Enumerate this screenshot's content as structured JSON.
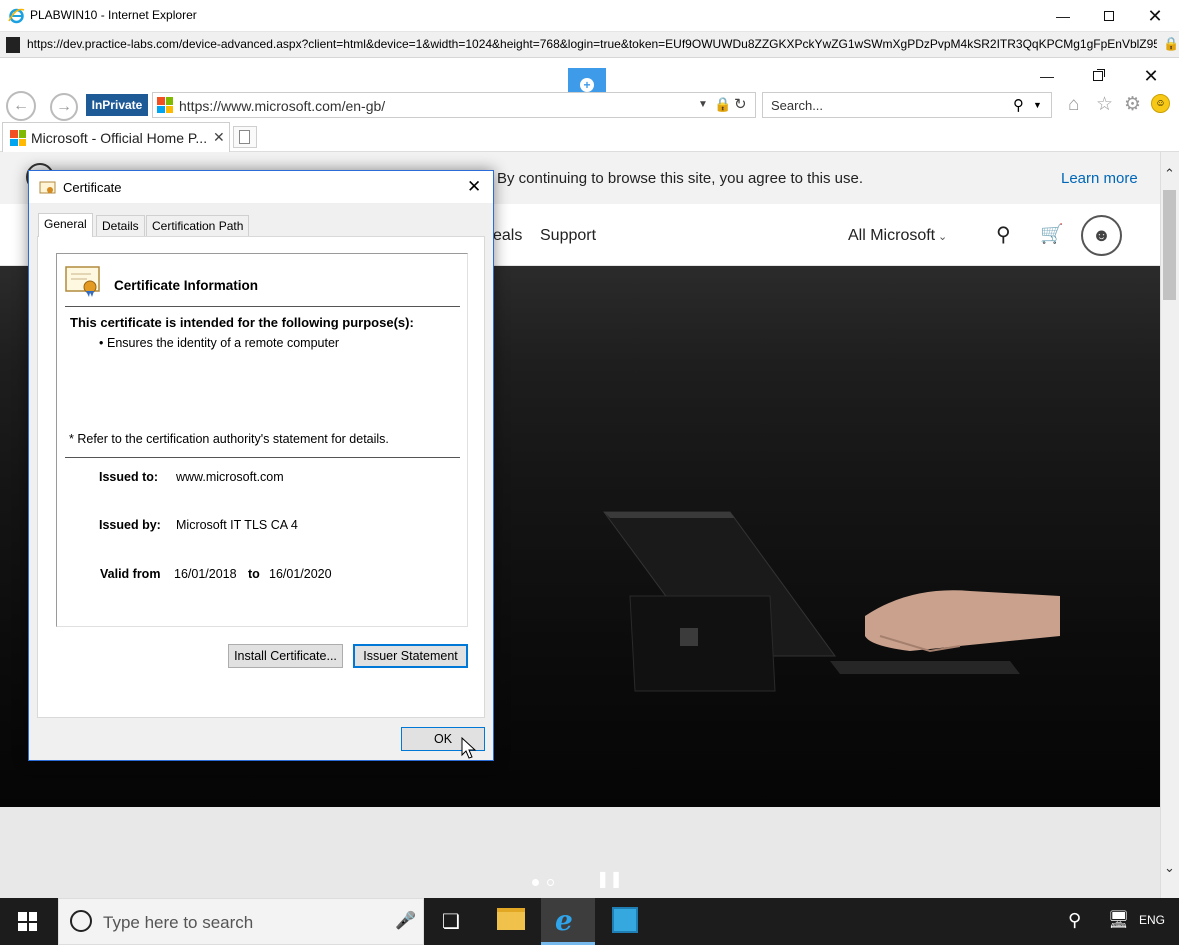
{
  "outer_window": {
    "title": "PLABWIN10 - Internet Explorer",
    "url": "https://dev.practice-labs.com/device-advanced.aspx?client=html&device=1&width=1024&height=768&login=true&token=EUf9OWUWDu8ZZGKXPckYwZG1wSWmXgPDzPvpM4kSR2ITR3QqKPCMg1gFpEnVblZ95T"
  },
  "browser": {
    "inprivate_label": "InPrivate",
    "address": "https://www.microsoft.com/en-gb/",
    "search_placeholder": "Search...",
    "tab_title": "Microsoft - Official Home P..."
  },
  "page": {
    "cookie_message": "By continuing to browse this site, you agree to this use.",
    "learn_more": "Learn more",
    "nav_partial": "eals",
    "nav_support": "Support",
    "nav_all_microsoft": "All Microsoft"
  },
  "dialog": {
    "title": "Certificate",
    "tabs": [
      "General",
      "Details",
      "Certification Path"
    ],
    "heading": "Certificate Information",
    "purpose_heading": "This certificate is intended for the following purpose(s):",
    "purpose_item": "Ensures the identity of a remote computer",
    "refer_note": "* Refer to the certification authority's statement for details.",
    "issued_to_label": "Issued to:",
    "issued_to": "www.microsoft.com",
    "issued_by_label": "Issued by:",
    "issued_by": "Microsoft IT TLS CA 4",
    "valid_from_label": "Valid from",
    "valid_from": "16/01/2018",
    "to_label": "to",
    "valid_to": "16/01/2020",
    "install_button": "Install Certificate...",
    "issuer_button": "Issuer Statement",
    "ok_button": "OK"
  },
  "taskbar": {
    "search_placeholder": "Type here to search",
    "language": "ENG"
  },
  "colors": {
    "inprivate_bg": "#1e5a96",
    "link_blue": "#0067b8",
    "dialog_border": "#2b6cd8",
    "taskbar_bg": "#1c1c1c"
  }
}
